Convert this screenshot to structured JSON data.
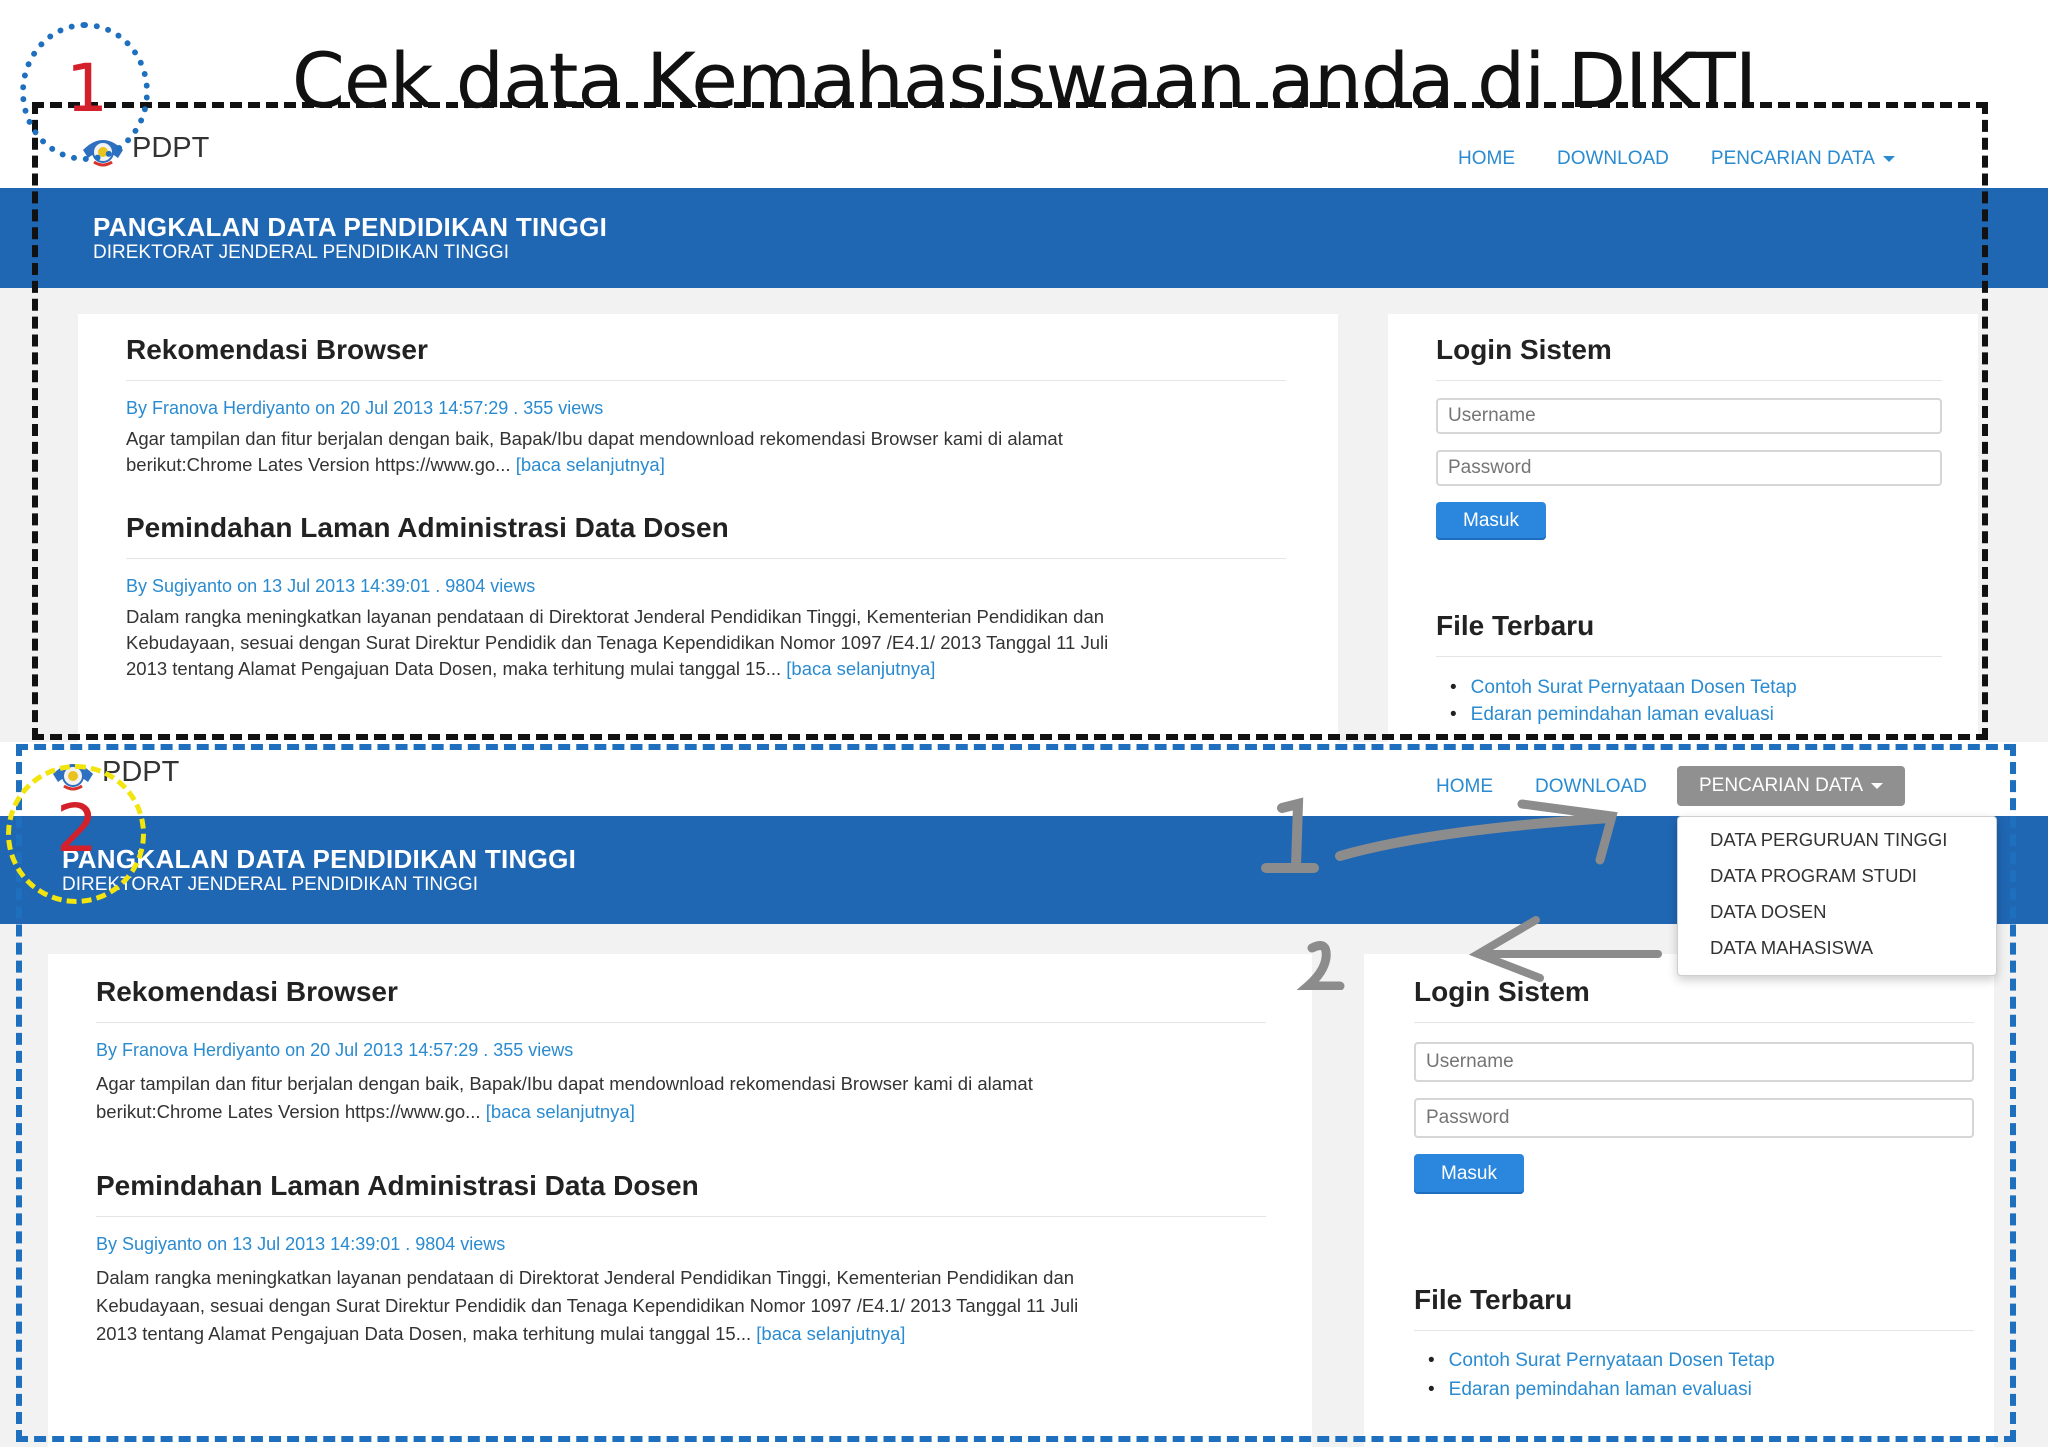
{
  "headline": "Cek data Kemahasiswaan anda di DIKTI",
  "steps": [
    "1",
    "2"
  ],
  "site": {
    "brand": "PDPT",
    "nav": [
      "HOME",
      "DOWNLOAD",
      "PENCARIAN DATA"
    ],
    "banner_title": "PANGKALAN DATA PENDIDIKAN TINGGI",
    "banner_subtitle": "DIREKTORAT JENDERAL PENDIDIKAN TINGGI"
  },
  "posts": [
    {
      "title": "Rekomendasi Browser",
      "meta": "By Franova Herdiyanto on 20 Jul 2013 14:57:29 . 355 views",
      "lines": [
        "Agar tampilan dan fitur berjalan dengan baik, Bapak/Ibu dapat mendownload rekomendasi Browser kami di alamat",
        "berikut:Chrome Lates Version https://www.go..."
      ],
      "more": "[baca selanjutnya]"
    },
    {
      "title": "Pemindahan Laman Administrasi Data Dosen",
      "meta": "By Sugiyanto on 13 Jul 2013 14:39:01 . 9804 views",
      "lines": [
        "Dalam rangka meningkatkan layanan pendataan di Direktorat Jenderal Pendidikan Tinggi, Kementerian Pendidikan dan",
        "Kebudayaan, sesuai dengan Surat Direktur Pendidik dan Tenaga Kependidikan Nomor 1097 /E4.1/ 2013 Tanggal 11 Juli",
        "2013 tentang Alamat Pengajuan Data Dosen, maka terhitung mulai tanggal 15..."
      ],
      "more": "[baca selanjutnya]"
    }
  ],
  "login": {
    "title": "Login Sistem",
    "username_placeholder": "Username",
    "password_placeholder": "Password",
    "button": "Masuk"
  },
  "files": {
    "title": "File Terbaru",
    "items": [
      "Contoh Surat Pernyataan Dosen Tetap",
      "Edaran pemindahan laman evaluasi"
    ]
  },
  "dropdown": [
    "DATA PERGURUAN TINGGI",
    "DATA PROGRAM STUDI",
    "DATA DOSEN",
    "DATA MAHASISWA"
  ],
  "colors": {
    "banner": "#1f66b3",
    "link": "#2a8bd0",
    "button": "#2a87dd",
    "step_number": "#d4202a"
  }
}
